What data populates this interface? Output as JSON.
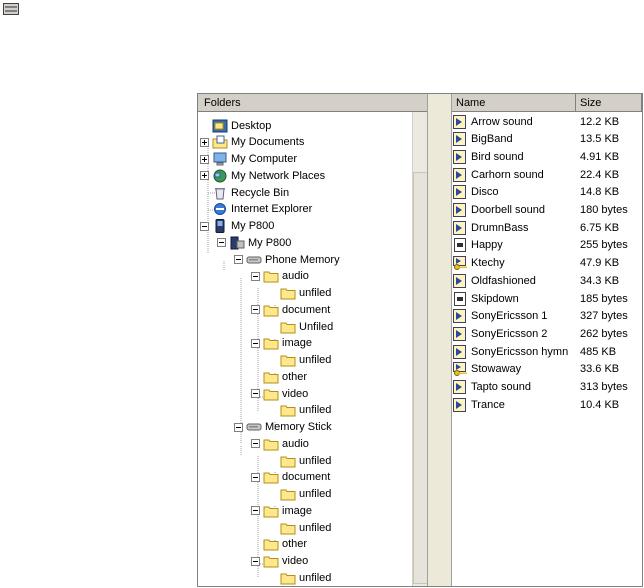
{
  "folders_header": "Folders",
  "columns": {
    "name": "Name",
    "size": "Size"
  },
  "tree": [
    {
      "label": "Desktop"
    },
    {
      "label": "My Documents"
    },
    {
      "label": "My Computer"
    },
    {
      "label": "My Network Places"
    },
    {
      "label": "Recycle Bin"
    },
    {
      "label": "Internet Explorer"
    },
    {
      "label": "My P800"
    },
    {
      "label": "My P800"
    },
    {
      "label": "Phone Memory"
    },
    {
      "label": "audio"
    },
    {
      "label": "unfiled"
    },
    {
      "label": "document"
    },
    {
      "label": "Unfiled"
    },
    {
      "label": "image"
    },
    {
      "label": "unfiled"
    },
    {
      "label": "other"
    },
    {
      "label": "video"
    },
    {
      "label": "unfiled"
    },
    {
      "label": "Memory Stick"
    },
    {
      "label": "audio"
    },
    {
      "label": "unfiled"
    },
    {
      "label": "document"
    },
    {
      "label": "unfiled"
    },
    {
      "label": "image"
    },
    {
      "label": "unfiled"
    },
    {
      "label": "other"
    },
    {
      "label": "video"
    },
    {
      "label": "unfiled"
    }
  ],
  "files": [
    {
      "name": "Arrow sound",
      "size": "12.2 KB",
      "icon": "media-icon"
    },
    {
      "name": "BigBand",
      "size": "13.5 KB",
      "icon": "media-icon"
    },
    {
      "name": "Bird sound",
      "size": "4.91 KB",
      "icon": "media-icon"
    },
    {
      "name": "Carhorn sound",
      "size": "22.4 KB",
      "icon": "media-icon"
    },
    {
      "name": "Disco",
      "size": "14.8 KB",
      "icon": "media-icon"
    },
    {
      "name": "Doorbell sound",
      "size": "180 bytes",
      "icon": "media-icon"
    },
    {
      "name": "DrumnBass",
      "size": "6.75 KB",
      "icon": "media-icon"
    },
    {
      "name": "Happy",
      "size": "255 bytes",
      "icon": "file-icon"
    },
    {
      "name": "Ktechy",
      "size": "47.9 KB",
      "icon": "audio-key-icon"
    },
    {
      "name": "Oldfashioned",
      "size": "34.3 KB",
      "icon": "media-icon"
    },
    {
      "name": "Skipdown",
      "size": "185 bytes",
      "icon": "file-icon"
    },
    {
      "name": "SonyEricsson 1",
      "size": "327 bytes",
      "icon": "media-icon"
    },
    {
      "name": "SonyEricsson 2",
      "size": "262 bytes",
      "icon": "media-icon"
    },
    {
      "name": "SonyEricsson hymn",
      "size": "485 KB",
      "icon": "media-icon"
    },
    {
      "name": "Stowaway",
      "size": "33.6 KB",
      "icon": "audio-key-icon"
    },
    {
      "name": "Tapto sound",
      "size": "313 bytes",
      "icon": "media-icon"
    },
    {
      "name": "Trance",
      "size": "10.4 KB",
      "icon": "media-icon"
    }
  ],
  "colors": {
    "header_bg": "#d4d0c8",
    "folder_yellow": "#ffe88c",
    "folder_border": "#b09018"
  }
}
